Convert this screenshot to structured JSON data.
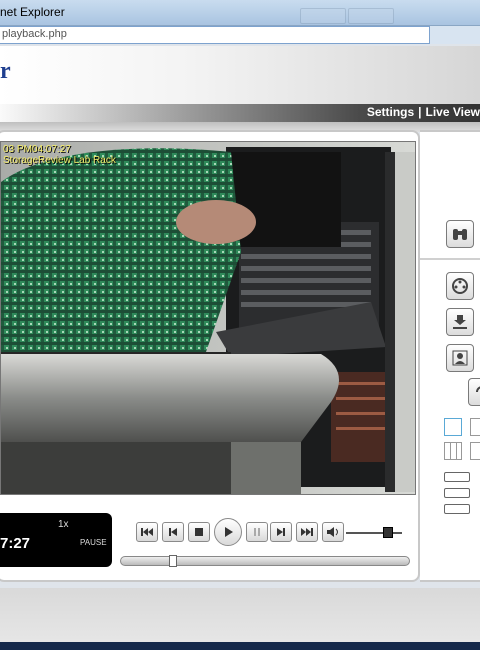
{
  "window": {
    "title": "net Explorer",
    "address": "playback.php"
  },
  "header": {
    "logo": "r"
  },
  "nav": {
    "settings": "Settings",
    "separator": "|",
    "live_view": "Live View"
  },
  "video": {
    "osd_datetime": "03 PM04:07:27",
    "osd_camera": "StorageReview Lab Rack"
  },
  "status": {
    "speed": "1x",
    "time": "7:27",
    "state": "PAUSE"
  },
  "controls": {
    "icons": [
      "skip-to-start-icon",
      "step-back-icon",
      "stop-icon",
      "play-icon",
      "pause-icon",
      "step-forward-icon",
      "skip-to-end-icon",
      "volume-icon"
    ],
    "volume_level": 0.8,
    "seek_position": 0.17
  },
  "right_panel": {
    "icons": [
      "binoculars-icon",
      "film-reel-icon",
      "download-icon",
      "user-contact-icon",
      "rotate-icon"
    ]
  },
  "colors": {
    "nav_text": "#ffffff",
    "osd_text": "#f4ec6a",
    "logo": "#1f3f8f",
    "bottom_bar": "#15294b"
  }
}
